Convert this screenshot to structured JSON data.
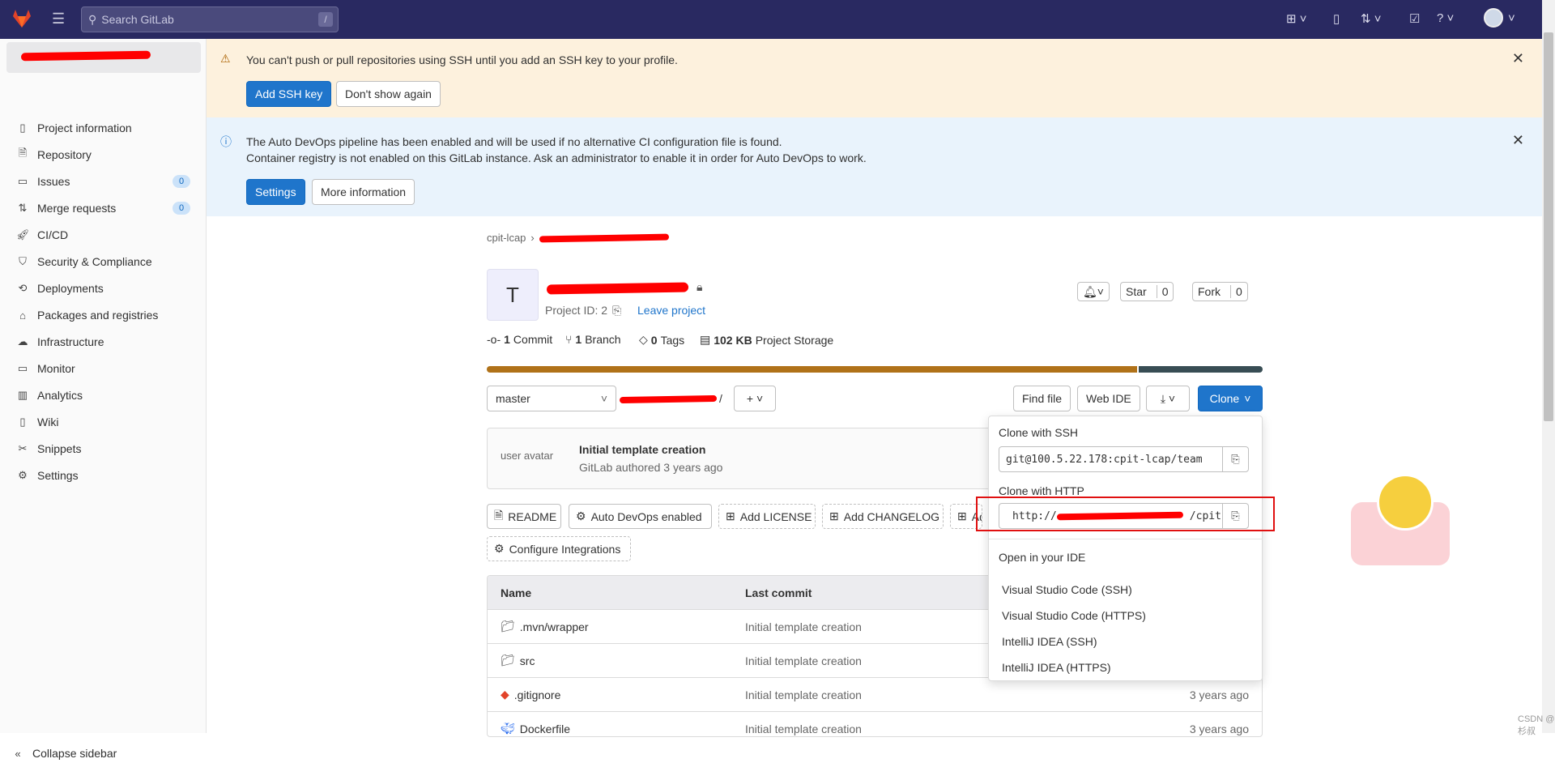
{
  "topbar": {
    "search_placeholder": "Search GitLab",
    "search_shortcut": "/"
  },
  "sidebar": {
    "items": [
      {
        "label": "Project information",
        "icon": "project-icon"
      },
      {
        "label": "Repository",
        "icon": "document-icon"
      },
      {
        "label": "Issues",
        "icon": "issues-icon",
        "count": "0"
      },
      {
        "label": "Merge requests",
        "icon": "merge-request-icon",
        "count": "0"
      },
      {
        "label": "CI/CD",
        "icon": "rocket-icon"
      },
      {
        "label": "Security & Compliance",
        "icon": "shield-icon"
      },
      {
        "label": "Deployments",
        "icon": "deployments-icon"
      },
      {
        "label": "Packages and registries",
        "icon": "package-icon"
      },
      {
        "label": "Infrastructure",
        "icon": "cloud-icon"
      },
      {
        "label": "Monitor",
        "icon": "monitor-icon"
      },
      {
        "label": "Analytics",
        "icon": "chart-icon"
      },
      {
        "label": "Wiki",
        "icon": "book-icon"
      },
      {
        "label": "Snippets",
        "icon": "scissors-icon"
      },
      {
        "label": "Settings",
        "icon": "gear-icon"
      }
    ],
    "collapse": "Collapse sidebar"
  },
  "ssh_banner": {
    "text": "You can't push or pull repositories using SSH until you add an SSH key to your profile.",
    "primary": "Add SSH key",
    "secondary": "Don't show again"
  },
  "devops_banner": {
    "line1": "The Auto DevOps pipeline has been enabled and will be used if no alternative CI configuration file is found.",
    "line2": "Container registry is not enabled on this GitLab instance. Ask an administrator to enable it in order for Auto DevOps to work.",
    "primary": "Settings",
    "secondary": "More information"
  },
  "breadcrumb": {
    "group": "cpit-lcap"
  },
  "project": {
    "avatar_letter": "T",
    "id_label": "Project ID: 2",
    "leave": "Leave project",
    "star": "Star",
    "star_count": "0",
    "fork": "Fork",
    "fork_count": "0",
    "stats": {
      "commits_n": "1",
      "commits": "Commit",
      "branches_n": "1",
      "branches": "Branch",
      "tags_n": "0",
      "tags": "Tags",
      "storage_n": "102 KB",
      "storage": "Project Storage"
    },
    "language_bar": [
      {
        "share": 0.84,
        "color": "#b07219"
      },
      {
        "share": 0.16,
        "color": "#384d54"
      }
    ]
  },
  "repo_toolbar": {
    "branch": "master",
    "path_sep": "/",
    "find_file": "Find file",
    "web_ide": "Web IDE",
    "clone": "Clone"
  },
  "last_commit": {
    "avatar_alt": "user avatar",
    "title": "Initial template creation",
    "meta": "GitLab authored 3 years ago"
  },
  "quick_actions": [
    "README",
    "Auto DevOps enabled",
    "Add LICENSE",
    "Add CHANGELOG",
    "Ad",
    "Configure Integrations"
  ],
  "table": {
    "headers": [
      "Name",
      "Last commit"
    ],
    "rows": [
      {
        "name": ".mvn/wrapper",
        "commit": "Initial template creation",
        "date": ""
      },
      {
        "name": "src",
        "commit": "Initial template creation",
        "date": ""
      },
      {
        "name": ".gitignore",
        "commit": "Initial template creation",
        "date": "3 years ago"
      },
      {
        "name": "Dockerfile",
        "commit": "Initial template creation",
        "date": "3 years ago"
      }
    ]
  },
  "clone_dropdown": {
    "ssh_label": "Clone with SSH",
    "ssh_url": "git@100.5.22.178:cpit-lcap/team",
    "http_label": "Clone with HTTP",
    "http_url_start": "http://",
    "http_url_end": "/cpit-",
    "ide_label": "Open in your IDE",
    "ide_items": [
      "Visual Studio Code (SSH)",
      "Visual Studio Code (HTTPS)",
      "IntelliJ IDEA (SSH)",
      "IntelliJ IDEA (HTTPS)"
    ]
  },
  "watermark": "CSDN @杉叔"
}
